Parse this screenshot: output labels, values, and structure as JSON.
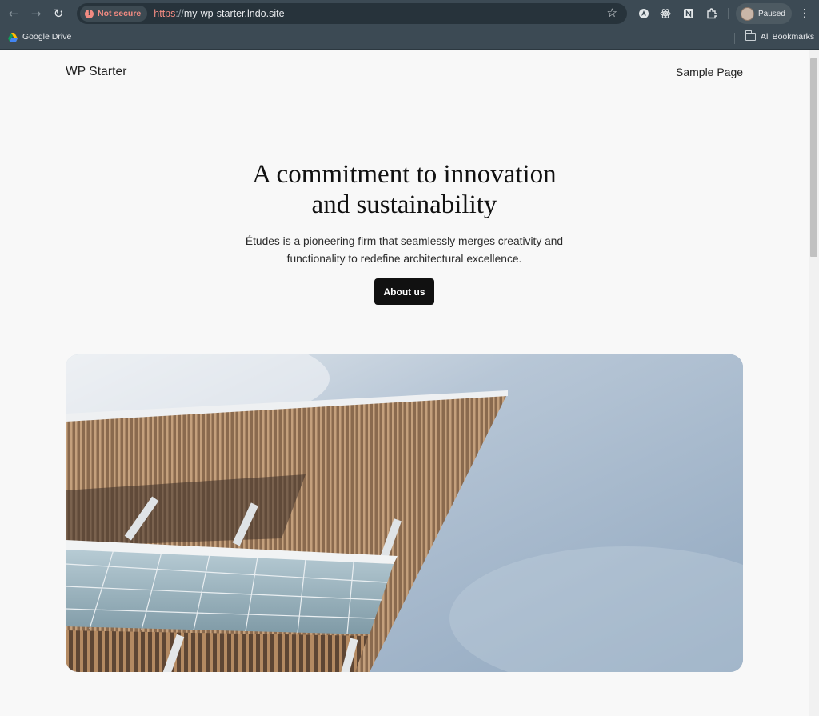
{
  "browser": {
    "security_label": "Not secure",
    "url_scheme": "https",
    "url_separator": "://",
    "url_host": "my-wp-starter.lndo.site",
    "profile_label": "Paused",
    "bookmarks": {
      "items": [
        {
          "label": "Google Drive",
          "icon": "google-drive-icon"
        }
      ],
      "all_bookmarks_label": "All Bookmarks"
    },
    "extensions": [
      "extension-a-icon",
      "react-devtools-icon",
      "notion-icon",
      "puzzle-piece-icon"
    ]
  },
  "site": {
    "title": "WP Starter",
    "nav": [
      {
        "label": "Sample Page"
      }
    ]
  },
  "hero": {
    "heading_line1": "A commitment to innovation",
    "heading_line2": "and sustainability",
    "description_line1": "Études is a pioneering firm that seamlessly merges creativity and",
    "description_line2": "functionality to redefine architectural excellence.",
    "button_label": "About us",
    "image": "architecture-building-against-sky"
  },
  "colors": {
    "chrome_bg": "#3c4a54",
    "page_bg": "#f8f8f8",
    "button_bg": "#111111",
    "insecure_red": "#f28b82"
  }
}
